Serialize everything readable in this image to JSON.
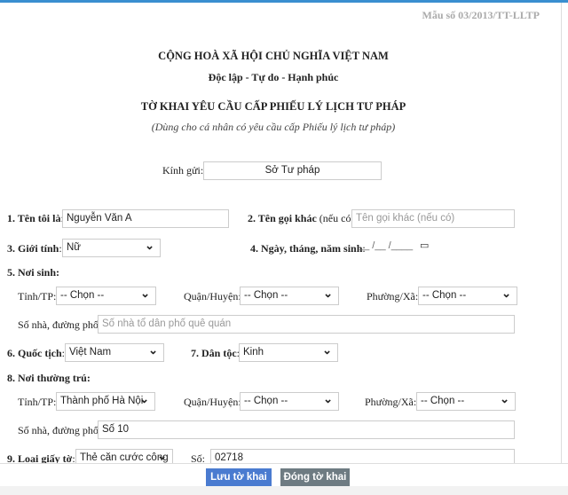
{
  "form_code": "Mẫu số 03/2013/TT-LLTP",
  "header": {
    "country": "CỘNG HOÀ XÃ HỘI CHỦ NGHĨA VIỆT NAM",
    "motto": "Độc lập - Tự do - Hạnh phúc",
    "title": "TỜ KHAI YÊU CẦU CẤP PHIẾU LÝ LỊCH TƯ PHÁP",
    "subtitle": "(Dùng cho cá nhân có yêu cầu cấp Phiếu lý lịch tư pháp)"
  },
  "recipient": {
    "label": "Kính gửi:",
    "value": "Sở Tư pháp"
  },
  "fields": {
    "name": {
      "label": "1. Tên tôi là",
      "value": "Nguyễn Văn A"
    },
    "alias": {
      "label": "2. Tên gọi khác",
      "note": "(nếu có):",
      "placeholder": "Tên gọi khác (nếu có)"
    },
    "gender": {
      "label": "3. Giới tính",
      "value": "Nữ"
    },
    "dob": {
      "label": "4. Ngày, tháng, năm sinh",
      "value": "__ /__ /____"
    },
    "birthplace": {
      "label": "5. Nơi sinh:",
      "province_label": "Tỉnh/TP:",
      "province": "-- Chọn --",
      "district_label": "Quận/Huyện:",
      "district": "-- Chọn --",
      "ward_label": "Phường/Xã:",
      "ward": "-- Chọn --",
      "street_label": "Số nhà, đường phố:",
      "street_placeholder": "Số nhà tổ dân phố  quê quán"
    },
    "nationality": {
      "label": "6. Quốc tịch",
      "value": "Việt Nam"
    },
    "ethnicity": {
      "label": "7. Dân tộc",
      "value": "Kinh"
    },
    "residence": {
      "label": "8. Nơi thường trú:",
      "province_label": "Tỉnh/TP:",
      "province": "Thành phố Hà Nội",
      "district_label": "Quận/Huyện:",
      "district": "-- Chọn --",
      "ward_label": "Phường/Xã:",
      "ward": "-- Chọn --",
      "street_label": "Số nhà, đường phố:",
      "street": "Số 10"
    },
    "id_doc": {
      "label": "9. Loại giấy tờ",
      "type": "Thẻ căn cước công",
      "number_label": "Số:",
      "number": "02718"
    }
  },
  "buttons": {
    "save": "Lưu tờ khai",
    "close": "Đóng tờ khai"
  },
  "colors": {
    "save": "#4a7bd0",
    "close": "#6e7b82",
    "topbar": "#3a8fd0"
  }
}
